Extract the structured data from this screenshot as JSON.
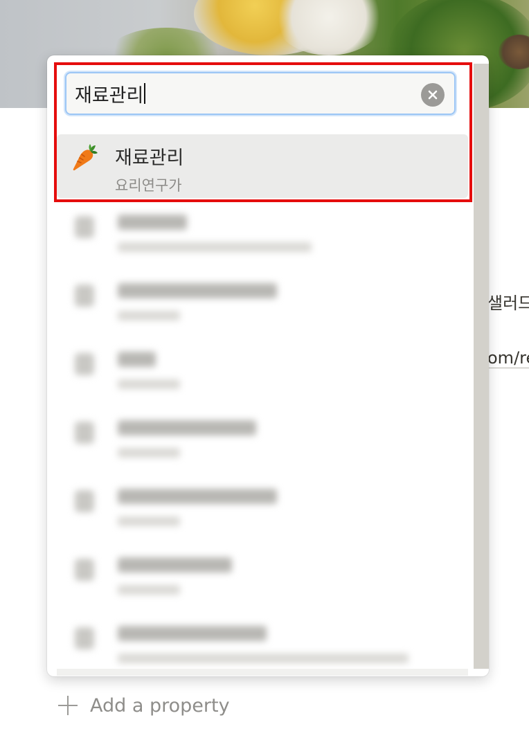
{
  "search": {
    "value": "재료관리"
  },
  "result": {
    "icon": "carrot-icon",
    "title": "재료관리",
    "subtitle": "요리연구가"
  },
  "background": {
    "partial_text_1": "샐러드",
    "partial_text_2": "om/re",
    "add_property_label": "Add a property"
  },
  "blurred_rows": 7,
  "colors": {
    "highlight_border": "#e50d0d",
    "focus_ring": "#9cc6f5",
    "selected_row_bg": "#ebebea"
  }
}
